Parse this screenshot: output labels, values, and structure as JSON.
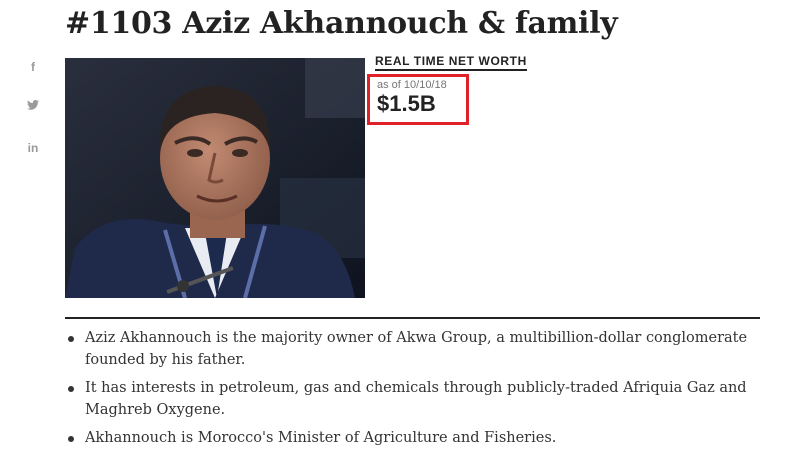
{
  "profile": {
    "title": "#1103 Aziz Akhannouch & family",
    "net_worth_label": "REAL TIME NET WORTH",
    "as_of": "as of 10/10/18",
    "net_worth": "$1.5B",
    "photo_alt": "Aziz Akhannouch"
  },
  "social": {
    "facebook_label": "f",
    "twitter_icon": "twitter-bird-icon",
    "linkedin_label": "in"
  },
  "facts": [
    "Aziz Akhannouch is the majority owner of Akwa Group, a multibillion-dollar conglomerate founded by his father.",
    "It has interests in petroleum, gas and chemicals through publicly-traded Afriquia Gaz and Maghreb Oxygene.",
    "Akhannouch is Morocco's Minister of Agriculture and Fisheries."
  ],
  "colors": {
    "highlight_box": "#e0212a",
    "text": "#222222",
    "social_icon": "#9a9a9a"
  }
}
